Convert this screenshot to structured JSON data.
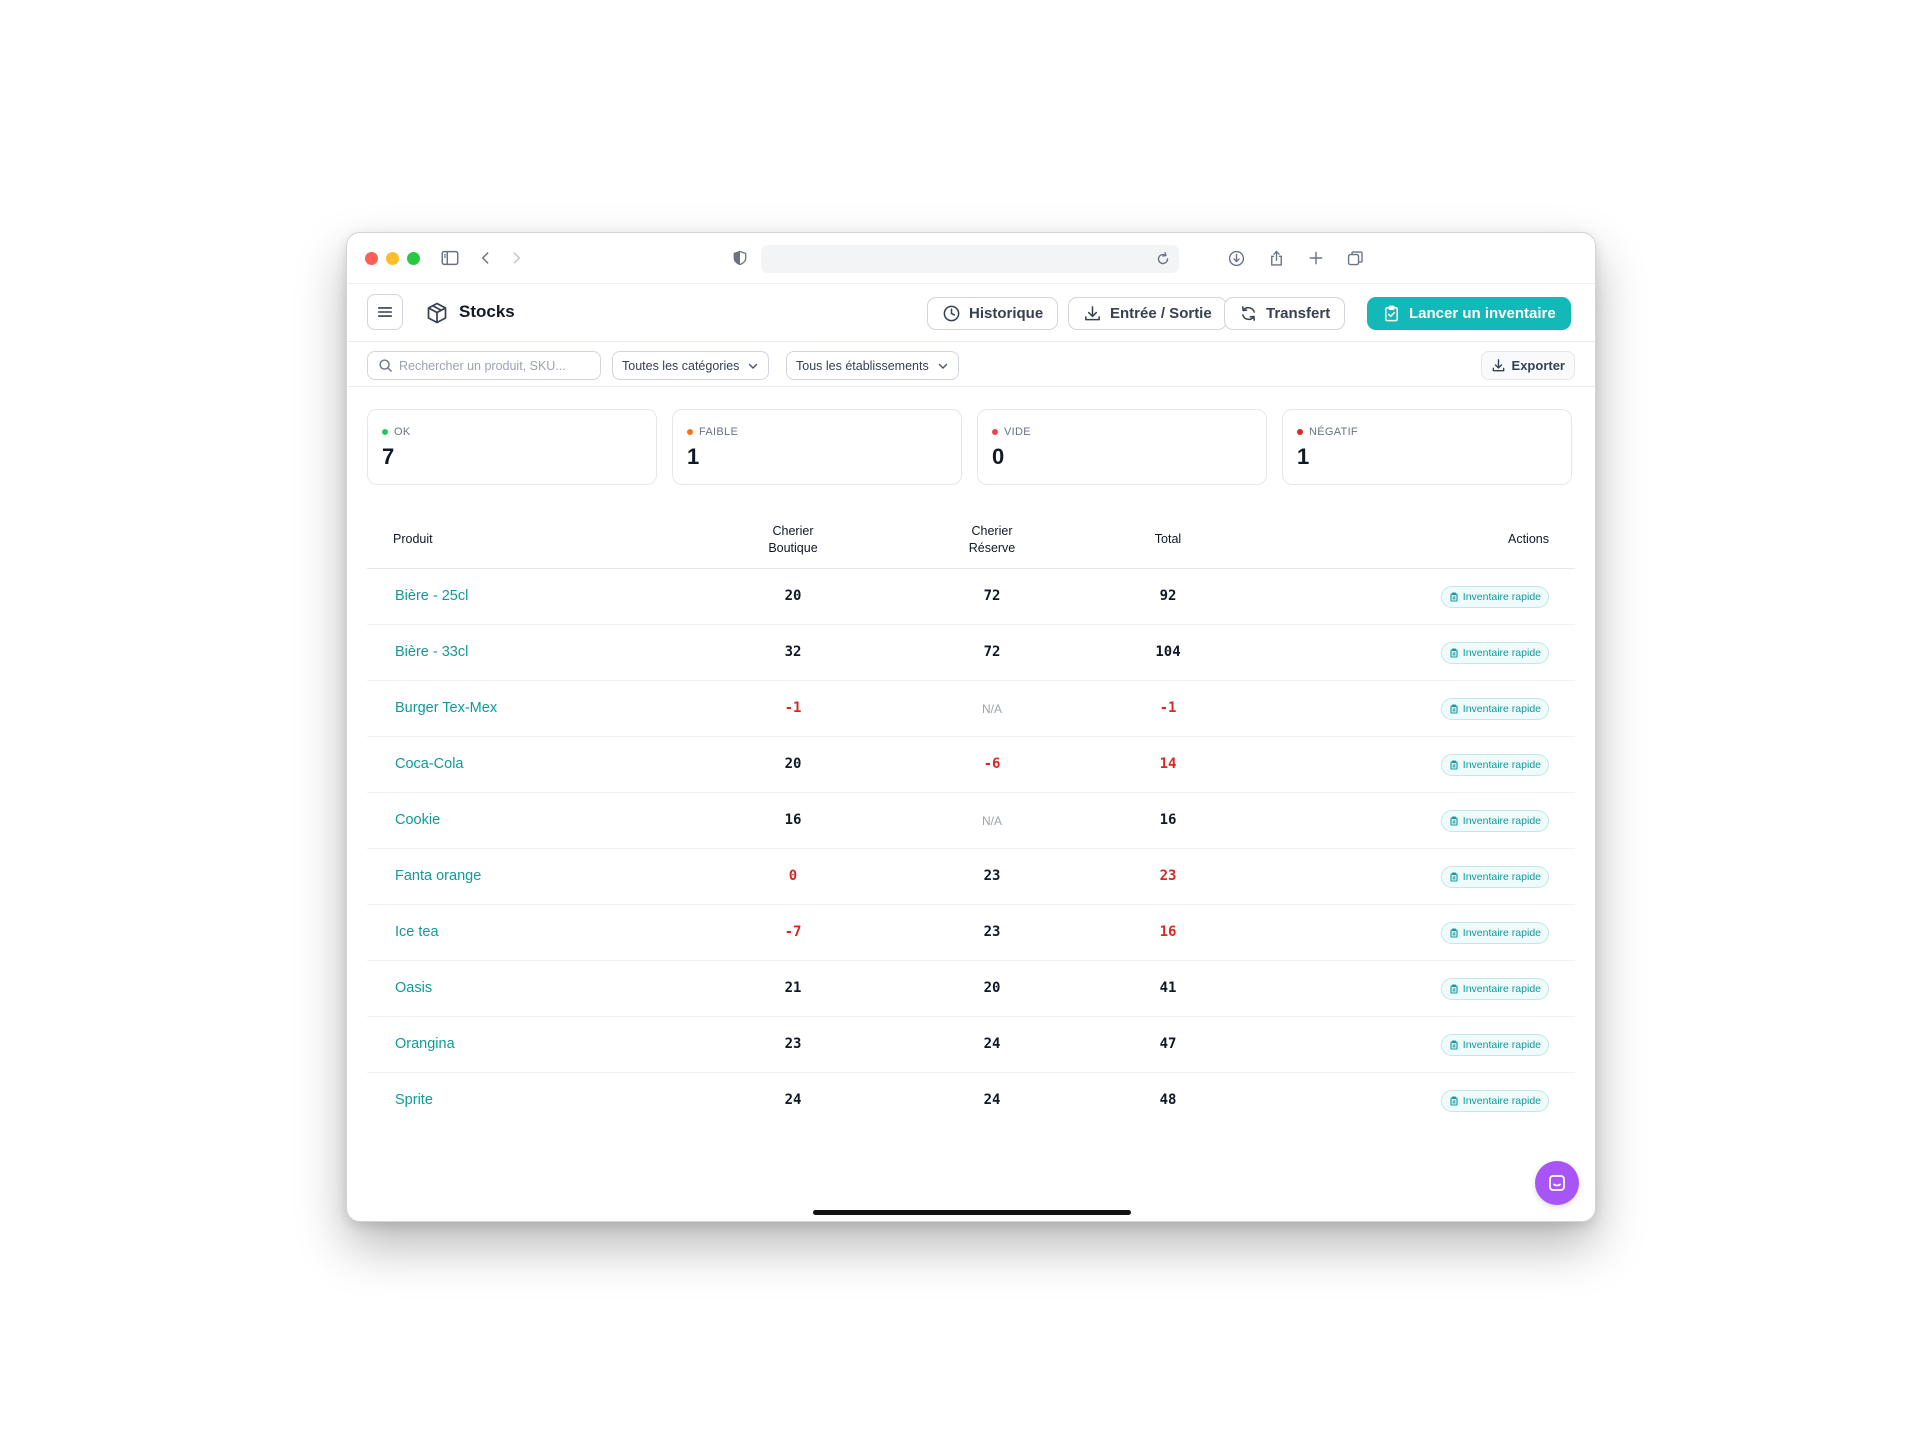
{
  "colors": {
    "accent": "#14b8b8",
    "ok": "#22c55e",
    "low": "#f97316",
    "empty": "#ef4444",
    "negative": "#dc2626",
    "chat": "#a855f7"
  },
  "header": {
    "title": "Stocks",
    "buttons": {
      "history": "Historique",
      "in_out": "Entrée / Sortie",
      "transfer": "Transfert",
      "inventory": "Lancer un inventaire"
    }
  },
  "filters": {
    "search_placeholder": "Rechercher un produit, SKU...",
    "category": "Toutes les catégories",
    "establishment": "Tous les établissements",
    "export": "Exporter"
  },
  "stats": [
    {
      "label": "OK",
      "value": "7"
    },
    {
      "label": "FAIBLE",
      "value": "1"
    },
    {
      "label": "VIDE",
      "value": "0"
    },
    {
      "label": "NÉGATIF",
      "value": "1"
    }
  ],
  "table": {
    "columns": {
      "product": "Produit",
      "col1_line1": "Cherier",
      "col1_line2": "Boutique",
      "col2_line1": "Cherier",
      "col2_line2": "Réserve",
      "total": "Total",
      "actions": "Actions"
    },
    "action_label": "Inventaire rapide",
    "rows": [
      {
        "name": "Bière - 25cl",
        "boutique": "20",
        "reserve": "72",
        "total": "92"
      },
      {
        "name": "Bière - 33cl",
        "boutique": "32",
        "reserve": "72",
        "total": "104"
      },
      {
        "name": "Burger Tex-Mex",
        "boutique": "-1",
        "reserve": "N/A",
        "total": "-1"
      },
      {
        "name": "Coca-Cola",
        "boutique": "20",
        "reserve": "-6",
        "total": "14"
      },
      {
        "name": "Cookie",
        "boutique": "16",
        "reserve": "N/A",
        "total": "16"
      },
      {
        "name": "Fanta orange",
        "boutique": "0",
        "reserve": "23",
        "total": "23"
      },
      {
        "name": "Ice tea",
        "boutique": "-7",
        "reserve": "23",
        "total": "16"
      },
      {
        "name": "Oasis",
        "boutique": "21",
        "reserve": "20",
        "total": "41"
      },
      {
        "name": "Orangina",
        "boutique": "23",
        "reserve": "24",
        "total": "47"
      },
      {
        "name": "Sprite",
        "boutique": "24",
        "reserve": "24",
        "total": "48"
      }
    ]
  }
}
